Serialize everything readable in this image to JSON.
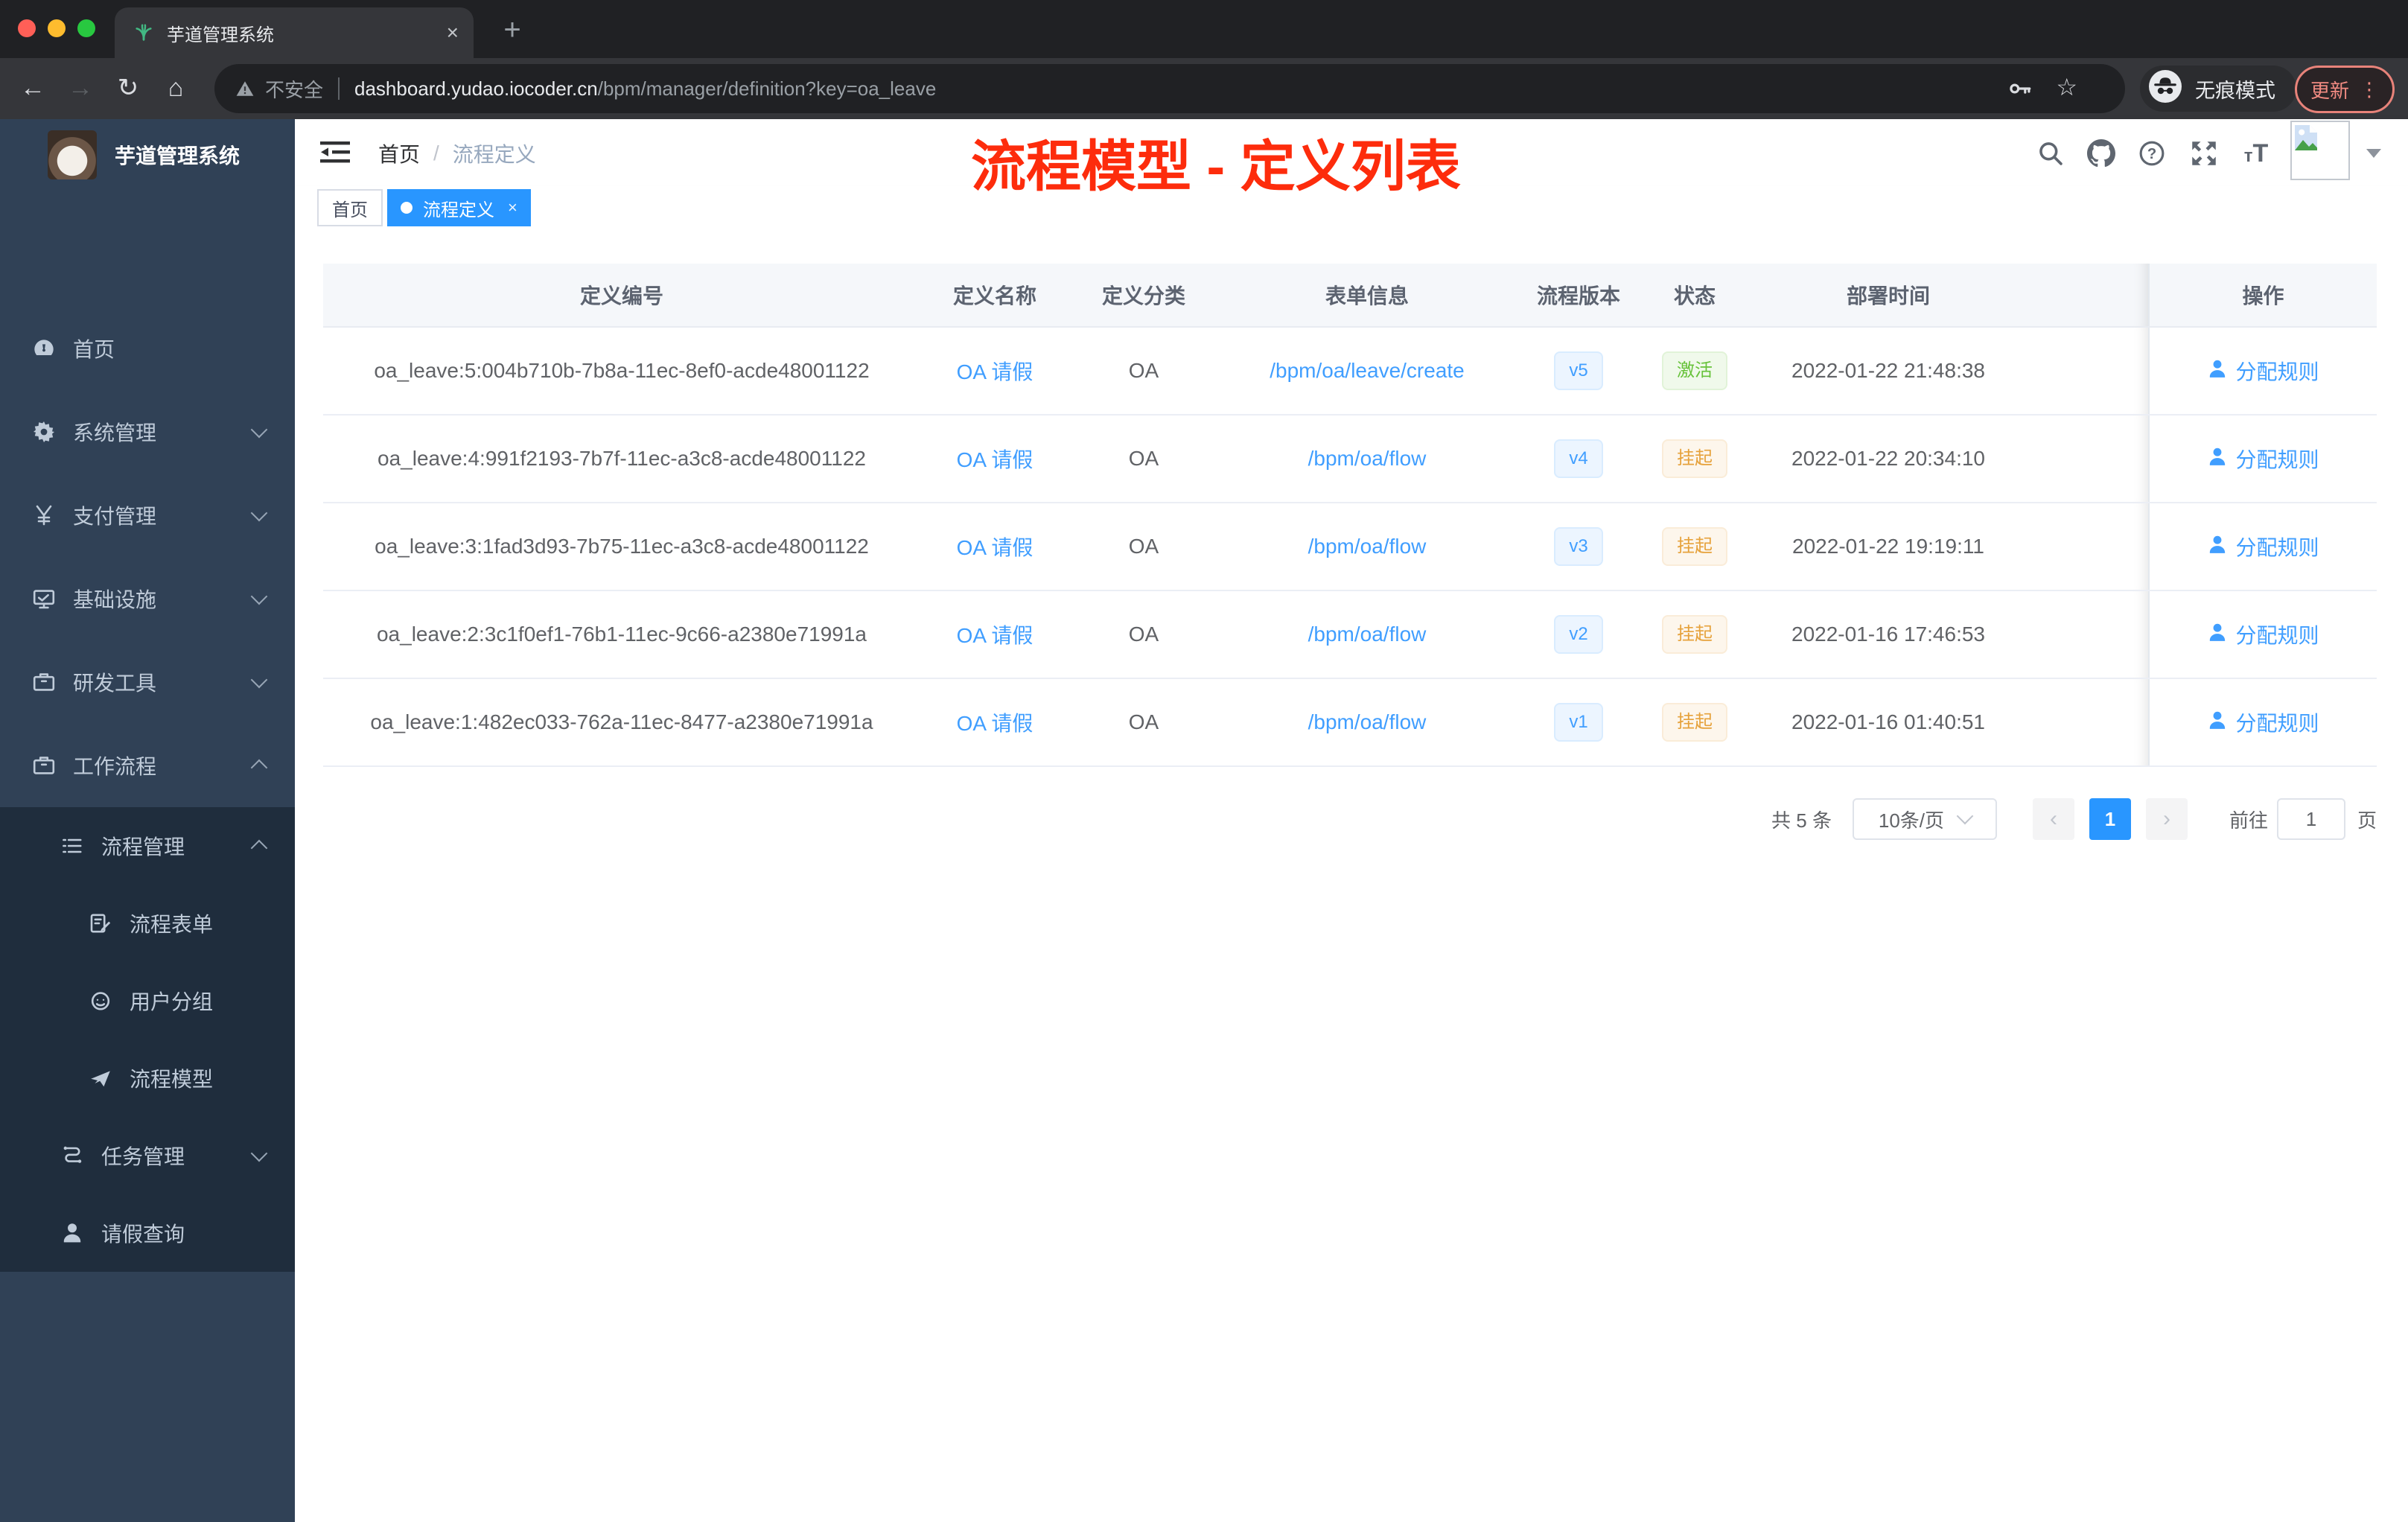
{
  "browser": {
    "tab_title": "芋道管理系统",
    "security_label": "不安全",
    "url_host": "dashboard.yudao.iocoder.cn",
    "url_path": "/bpm/manager/definition?key=oa_leave",
    "incognito_label": "无痕模式",
    "update_label": "更新"
  },
  "sidebar": {
    "app_title": "芋道管理系统",
    "menu": [
      {
        "label": "首页",
        "icon": "dashboard-icon",
        "level": 1,
        "arrow": "",
        "dark": false
      },
      {
        "label": "系统管理",
        "icon": "gear-icon",
        "level": 1,
        "arrow": "down",
        "dark": false
      },
      {
        "label": "支付管理",
        "icon": "yen-icon",
        "level": 1,
        "arrow": "down",
        "dark": false
      },
      {
        "label": "基础设施",
        "icon": "monitor-icon",
        "level": 1,
        "arrow": "down",
        "dark": false
      },
      {
        "label": "研发工具",
        "icon": "briefcase-icon",
        "level": 1,
        "arrow": "down",
        "dark": false
      },
      {
        "label": "工作流程",
        "icon": "briefcase-icon",
        "level": 1,
        "arrow": "up",
        "dark": false
      },
      {
        "label": "流程管理",
        "icon": "list-icon",
        "level": 2,
        "arrow": "up",
        "dark": true
      },
      {
        "label": "流程表单",
        "icon": "form-icon",
        "level": 3,
        "arrow": "",
        "dark": true
      },
      {
        "label": "用户分组",
        "icon": "face-icon",
        "level": 3,
        "arrow": "",
        "dark": true
      },
      {
        "label": "流程模型",
        "icon": "send-icon",
        "level": 3,
        "arrow": "",
        "dark": true
      },
      {
        "label": "任务管理",
        "icon": "flow-icon",
        "level": 2,
        "arrow": "down",
        "dark": true
      },
      {
        "label": "请假查询",
        "icon": "person-icon",
        "level": 2,
        "arrow": "",
        "dark": true
      }
    ]
  },
  "navbar": {
    "breadcrumb_home": "首页",
    "breadcrumb_sep": "/",
    "breadcrumb_current": "流程定义"
  },
  "annotation": {
    "text": "流程模型 - 定义列表",
    "color": "#fd2c0c"
  },
  "tags": {
    "home_label": "首页",
    "active_label": "流程定义",
    "active_close": "×"
  },
  "table": {
    "columns": [
      "定义编号",
      "定义名称",
      "定义分类",
      "表单信息",
      "流程版本",
      "状态",
      "部署时间",
      "操作"
    ],
    "action_label": "分配规则",
    "rows": [
      {
        "id": "oa_leave:5:004b710b-7b8a-11ec-8ef0-acde48001122",
        "name": "OA 请假",
        "category": "OA",
        "form": "/bpm/oa/leave/create",
        "version": "v5",
        "status": "激活",
        "status_type": "success",
        "deploy_time": "2022-01-22 21:48:38"
      },
      {
        "id": "oa_leave:4:991f2193-7b7f-11ec-a3c8-acde48001122",
        "name": "OA 请假",
        "category": "OA",
        "form": "/bpm/oa/flow",
        "version": "v4",
        "status": "挂起",
        "status_type": "warning",
        "deploy_time": "2022-01-22 20:34:10"
      },
      {
        "id": "oa_leave:3:1fad3d93-7b75-11ec-a3c8-acde48001122",
        "name": "OA 请假",
        "category": "OA",
        "form": "/bpm/oa/flow",
        "version": "v3",
        "status": "挂起",
        "status_type": "warning",
        "deploy_time": "2022-01-22 19:19:11"
      },
      {
        "id": "oa_leave:2:3c1f0ef1-76b1-11ec-9c66-a2380e71991a",
        "name": "OA 请假",
        "category": "OA",
        "form": "/bpm/oa/flow",
        "version": "v2",
        "status": "挂起",
        "status_type": "warning",
        "deploy_time": "2022-01-16 17:46:53"
      },
      {
        "id": "oa_leave:1:482ec033-762a-11ec-8477-a2380e71991a",
        "name": "OA 请假",
        "category": "OA",
        "form": "/bpm/oa/flow",
        "version": "v1",
        "status": "挂起",
        "status_type": "warning",
        "deploy_time": "2022-01-16 01:40:51"
      }
    ]
  },
  "pagination": {
    "total": "共 5 条",
    "page_size": "10条/页",
    "current_page": "1",
    "prev": "‹",
    "next": "›",
    "goto_label": "前往",
    "goto_value": "1",
    "page_unit": "页"
  },
  "colors": {
    "accent": "#2996ff",
    "link": "#409eff",
    "annotation_red": "#fd2c0c",
    "sidebar_bg": "#304156",
    "submenu_bg": "#1f2d3d",
    "success_text": "#67c23a",
    "warning_text": "#e6a23c"
  }
}
